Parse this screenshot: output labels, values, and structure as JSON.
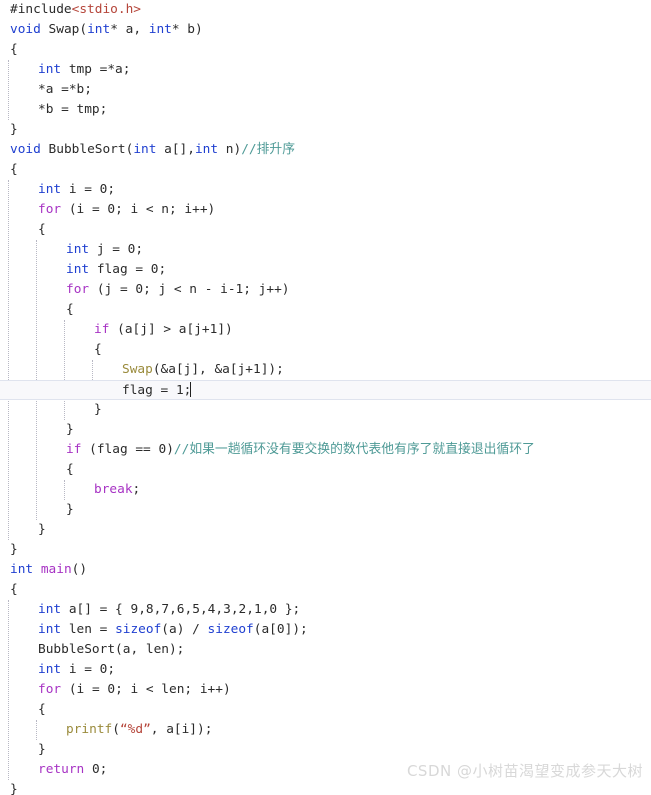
{
  "editor": {
    "app": "visual-studio-code-editor",
    "language": "c",
    "current_line_number": 19,
    "caret_after": "flag = 1;",
    "colors": {
      "background": "#ffffff",
      "foreground": "#2b2b2b",
      "keyword": "#1f3fd0",
      "control_keyword": "#a733c4",
      "function": "#9a8b3c",
      "string": "#b5453a",
      "comment": "#4e9a96",
      "current_line_bg": "#f8f8fb",
      "current_line_border": "#dfe3ee",
      "indent_guide": "#b8b8c4",
      "watermark": "#d8d8d8"
    },
    "indent_guides_x": [
      8,
      36,
      64,
      92
    ],
    "lines": [
      {
        "n": 1,
        "indent": 0,
        "tokens": [
          {
            "t": "pre",
            "v": "#include"
          },
          {
            "t": "str",
            "v": "<stdio.h>"
          }
        ]
      },
      {
        "n": 2,
        "indent": 0,
        "tokens": [
          {
            "t": "kw",
            "v": "void"
          },
          {
            "t": "plain",
            "v": " "
          },
          {
            "t": "fn2",
            "v": "Swap"
          },
          {
            "t": "plain",
            "v": "("
          },
          {
            "t": "kw",
            "v": "int"
          },
          {
            "t": "plain",
            "v": "* a, "
          },
          {
            "t": "kw",
            "v": "int"
          },
          {
            "t": "plain",
            "v": "* b)"
          }
        ]
      },
      {
        "n": 3,
        "indent": 0,
        "tokens": [
          {
            "t": "brace",
            "v": "{"
          }
        ]
      },
      {
        "n": 4,
        "indent": 1,
        "tokens": [
          {
            "t": "kw",
            "v": "int"
          },
          {
            "t": "plain",
            "v": " tmp =*a;"
          }
        ]
      },
      {
        "n": 5,
        "indent": 1,
        "tokens": [
          {
            "t": "plain",
            "v": "*a =*b;"
          }
        ]
      },
      {
        "n": 6,
        "indent": 1,
        "tokens": [
          {
            "t": "plain",
            "v": "*b = tmp;"
          }
        ]
      },
      {
        "n": 7,
        "indent": 0,
        "tokens": [
          {
            "t": "brace",
            "v": "}"
          }
        ]
      },
      {
        "n": 8,
        "indent": 0,
        "tokens": [
          {
            "t": "kw",
            "v": "void"
          },
          {
            "t": "plain",
            "v": " "
          },
          {
            "t": "fn2",
            "v": "BubbleSort"
          },
          {
            "t": "plain",
            "v": "("
          },
          {
            "t": "kw",
            "v": "int"
          },
          {
            "t": "plain",
            "v": " a[],"
          },
          {
            "t": "kw",
            "v": "int"
          },
          {
            "t": "plain",
            "v": " n)"
          },
          {
            "t": "cmt",
            "v": "//排升序"
          }
        ]
      },
      {
        "n": 9,
        "indent": 0,
        "tokens": [
          {
            "t": "brace",
            "v": "{"
          }
        ]
      },
      {
        "n": 10,
        "indent": 1,
        "tokens": [
          {
            "t": "kw",
            "v": "int"
          },
          {
            "t": "plain",
            "v": " i = "
          },
          {
            "t": "num",
            "v": "0"
          },
          {
            "t": "plain",
            "v": ";"
          }
        ]
      },
      {
        "n": 11,
        "indent": 1,
        "tokens": [
          {
            "t": "ctl",
            "v": "for"
          },
          {
            "t": "plain",
            "v": " (i = "
          },
          {
            "t": "num",
            "v": "0"
          },
          {
            "t": "plain",
            "v": "; i < n; i++)"
          }
        ]
      },
      {
        "n": 12,
        "indent": 1,
        "tokens": [
          {
            "t": "brace",
            "v": "{"
          }
        ]
      },
      {
        "n": 13,
        "indent": 2,
        "tokens": [
          {
            "t": "kw",
            "v": "int"
          },
          {
            "t": "plain",
            "v": " j = "
          },
          {
            "t": "num",
            "v": "0"
          },
          {
            "t": "plain",
            "v": ";"
          }
        ]
      },
      {
        "n": 14,
        "indent": 2,
        "tokens": [
          {
            "t": "kw",
            "v": "int"
          },
          {
            "t": "plain",
            "v": " flag = "
          },
          {
            "t": "num",
            "v": "0"
          },
          {
            "t": "plain",
            "v": ";"
          }
        ]
      },
      {
        "n": 15,
        "indent": 2,
        "tokens": [
          {
            "t": "ctl",
            "v": "for"
          },
          {
            "t": "plain",
            "v": " (j = "
          },
          {
            "t": "num",
            "v": "0"
          },
          {
            "t": "plain",
            "v": "; j < n - i-"
          },
          {
            "t": "num",
            "v": "1"
          },
          {
            "t": "plain",
            "v": "; j++)"
          }
        ]
      },
      {
        "n": 16,
        "indent": 2,
        "tokens": [
          {
            "t": "brace",
            "v": "{"
          }
        ]
      },
      {
        "n": 17,
        "indent": 3,
        "tokens": [
          {
            "t": "ctl",
            "v": "if"
          },
          {
            "t": "plain",
            "v": " (a[j] > a[j+"
          },
          {
            "t": "num",
            "v": "1"
          },
          {
            "t": "plain",
            "v": "])"
          }
        ]
      },
      {
        "n": 18,
        "indent": 3,
        "tokens": [
          {
            "t": "brace",
            "v": "{"
          }
        ]
      },
      {
        "n": 19,
        "indent": 4,
        "tokens": [
          {
            "t": "fn",
            "v": "Swap"
          },
          {
            "t": "plain",
            "v": "(&a[j], &a[j+"
          },
          {
            "t": "num",
            "v": "1"
          },
          {
            "t": "plain",
            "v": "]);"
          }
        ]
      },
      {
        "n": 20,
        "indent": 4,
        "current": true,
        "caret": true,
        "tokens": [
          {
            "t": "plain",
            "v": "flag = "
          },
          {
            "t": "num",
            "v": "1"
          },
          {
            "t": "plain",
            "v": ";"
          }
        ]
      },
      {
        "n": 21,
        "indent": 3,
        "tokens": [
          {
            "t": "brace",
            "v": "}"
          }
        ]
      },
      {
        "n": 22,
        "indent": 2,
        "tokens": [
          {
            "t": "brace",
            "v": "}"
          }
        ]
      },
      {
        "n": 23,
        "indent": 2,
        "tokens": [
          {
            "t": "ctl",
            "v": "if"
          },
          {
            "t": "plain",
            "v": " (flag == "
          },
          {
            "t": "num",
            "v": "0"
          },
          {
            "t": "plain",
            "v": ")"
          },
          {
            "t": "cmt",
            "v": "//如果一趟循环没有要交换的数代表他有序了就直接退出循环了"
          }
        ]
      },
      {
        "n": 24,
        "indent": 2,
        "tokens": [
          {
            "t": "brace",
            "v": "{"
          }
        ]
      },
      {
        "n": 25,
        "indent": 3,
        "tokens": [
          {
            "t": "ctl",
            "v": "break"
          },
          {
            "t": "plain",
            "v": ";"
          }
        ]
      },
      {
        "n": 26,
        "indent": 2,
        "tokens": [
          {
            "t": "brace",
            "v": "}"
          }
        ]
      },
      {
        "n": 27,
        "indent": 1,
        "tokens": [
          {
            "t": "brace",
            "v": "}"
          }
        ]
      },
      {
        "n": 28,
        "indent": 0,
        "tokens": [
          {
            "t": "brace",
            "v": "}"
          }
        ]
      },
      {
        "n": 29,
        "indent": 0,
        "tokens": [
          {
            "t": "kw",
            "v": "int"
          },
          {
            "t": "plain",
            "v": " "
          },
          {
            "t": "ctl",
            "v": "main"
          },
          {
            "t": "plain",
            "v": "()"
          }
        ]
      },
      {
        "n": 30,
        "indent": 0,
        "tokens": [
          {
            "t": "brace",
            "v": "{"
          }
        ]
      },
      {
        "n": 31,
        "indent": 1,
        "tokens": [
          {
            "t": "kw",
            "v": "int"
          },
          {
            "t": "plain",
            "v": " a[] = { "
          },
          {
            "t": "num",
            "v": "9"
          },
          {
            "t": "plain",
            "v": ","
          },
          {
            "t": "num",
            "v": "8"
          },
          {
            "t": "plain",
            "v": ","
          },
          {
            "t": "num",
            "v": "7"
          },
          {
            "t": "plain",
            "v": ","
          },
          {
            "t": "num",
            "v": "6"
          },
          {
            "t": "plain",
            "v": ","
          },
          {
            "t": "num",
            "v": "5"
          },
          {
            "t": "plain",
            "v": ","
          },
          {
            "t": "num",
            "v": "4"
          },
          {
            "t": "plain",
            "v": ","
          },
          {
            "t": "num",
            "v": "3"
          },
          {
            "t": "plain",
            "v": ","
          },
          {
            "t": "num",
            "v": "2"
          },
          {
            "t": "plain",
            "v": ","
          },
          {
            "t": "num",
            "v": "1"
          },
          {
            "t": "plain",
            "v": ","
          },
          {
            "t": "num",
            "v": "0"
          },
          {
            "t": "plain",
            "v": " };"
          }
        ]
      },
      {
        "n": 32,
        "indent": 1,
        "tokens": [
          {
            "t": "kw",
            "v": "int"
          },
          {
            "t": "plain",
            "v": " len = "
          },
          {
            "t": "kw",
            "v": "sizeof"
          },
          {
            "t": "plain",
            "v": "(a) / "
          },
          {
            "t": "kw",
            "v": "sizeof"
          },
          {
            "t": "plain",
            "v": "(a["
          },
          {
            "t": "num",
            "v": "0"
          },
          {
            "t": "plain",
            "v": "]);"
          }
        ]
      },
      {
        "n": 33,
        "indent": 1,
        "tokens": [
          {
            "t": "fn2",
            "v": "BubbleSort"
          },
          {
            "t": "plain",
            "v": "(a, len);"
          }
        ]
      },
      {
        "n": 34,
        "indent": 1,
        "tokens": [
          {
            "t": "kw",
            "v": "int"
          },
          {
            "t": "plain",
            "v": " i = "
          },
          {
            "t": "num",
            "v": "0"
          },
          {
            "t": "plain",
            "v": ";"
          }
        ]
      },
      {
        "n": 35,
        "indent": 1,
        "tokens": [
          {
            "t": "ctl",
            "v": "for"
          },
          {
            "t": "plain",
            "v": " (i = "
          },
          {
            "t": "num",
            "v": "0"
          },
          {
            "t": "plain",
            "v": "; i < len; i++)"
          }
        ]
      },
      {
        "n": 36,
        "indent": 1,
        "tokens": [
          {
            "t": "brace",
            "v": "{"
          }
        ]
      },
      {
        "n": 37,
        "indent": 2,
        "tokens": [
          {
            "t": "fn",
            "v": "printf"
          },
          {
            "t": "plain",
            "v": "("
          },
          {
            "t": "str",
            "v": "“%d”"
          },
          {
            "t": "plain",
            "v": ", a[i]);"
          }
        ]
      },
      {
        "n": 38,
        "indent": 1,
        "tokens": [
          {
            "t": "brace",
            "v": "}"
          }
        ]
      },
      {
        "n": 39,
        "indent": 1,
        "tokens": [
          {
            "t": "ctl",
            "v": "return"
          },
          {
            "t": "plain",
            "v": " "
          },
          {
            "t": "num",
            "v": "0"
          },
          {
            "t": "plain",
            "v": ";"
          }
        ]
      },
      {
        "n": 40,
        "indent": 0,
        "tokens": [
          {
            "t": "brace",
            "v": "}"
          }
        ]
      }
    ]
  },
  "watermark": {
    "text": "CSDN @小树苗渴望变成参天大树"
  }
}
